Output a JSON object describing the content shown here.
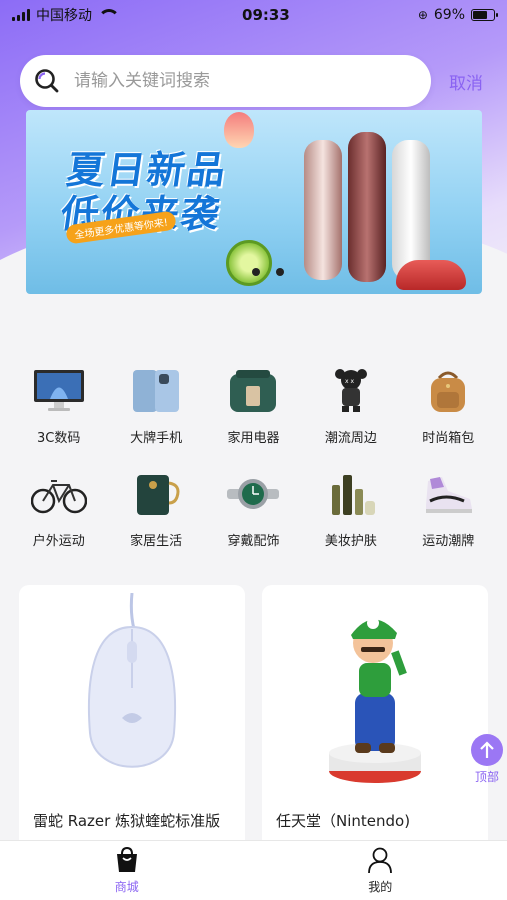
{
  "status_bar": {
    "carrier": "中国移动",
    "time": "09:33",
    "battery": "69%",
    "battery_level": 0.69
  },
  "search": {
    "placeholder": "请输入关键词搜索",
    "value": "",
    "cancel_label": "取消"
  },
  "banner": {
    "title_line1": "夏日新品",
    "title_line2": "低价来袭",
    "subtitle": "全场更多优惠等你来!",
    "page_count": 2
  },
  "categories": [
    {
      "label": "3C数码",
      "icon": "computer-icon"
    },
    {
      "label": "大牌手机",
      "icon": "phone-icon"
    },
    {
      "label": "家用电器",
      "icon": "appliance-icon"
    },
    {
      "label": "潮流周边",
      "icon": "figure-icon"
    },
    {
      "label": "时尚箱包",
      "icon": "backpack-icon"
    },
    {
      "label": "户外运动",
      "icon": "bicycle-icon"
    },
    {
      "label": "家居生活",
      "icon": "mug-icon"
    },
    {
      "label": "穿戴配饰",
      "icon": "watch-icon"
    },
    {
      "label": "美妆护肤",
      "icon": "cosmetics-icon"
    },
    {
      "label": "运动潮牌",
      "icon": "sneaker-icon"
    }
  ],
  "products": [
    {
      "title": "雷蛇 Razer 炼狱蝰蛇标准版",
      "image": "mouse-image"
    },
    {
      "title": "任天堂（Nintendo)",
      "image": "luigi-figure-image"
    }
  ],
  "back_to_top": {
    "label": "顶部"
  },
  "tabs": [
    {
      "label": "商城",
      "icon": "shopping-bag-icon",
      "active": true
    },
    {
      "label": "我的",
      "icon": "user-icon",
      "active": false
    }
  ],
  "colors": {
    "accent": "#8a63f2",
    "background": "#f4f4f6"
  }
}
